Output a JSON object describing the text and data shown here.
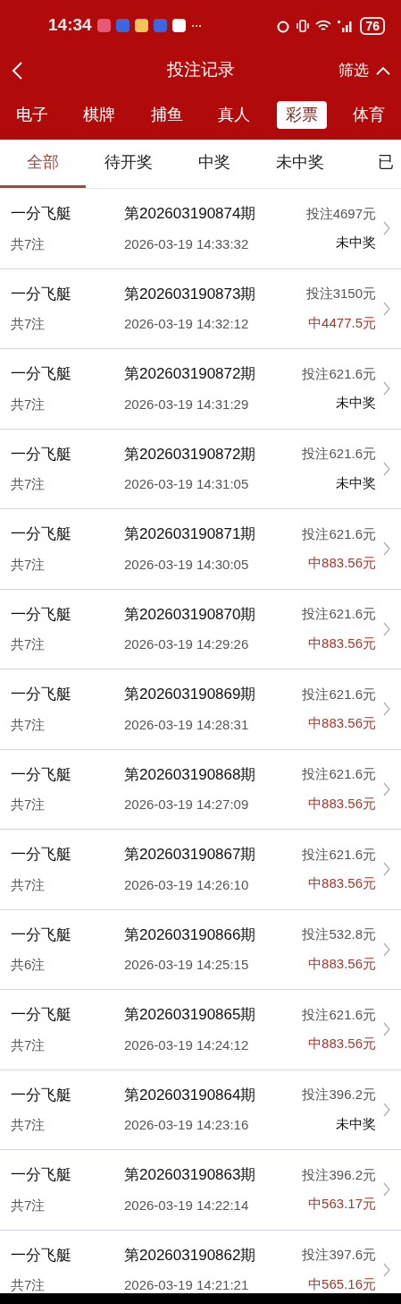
{
  "status_bar": {
    "time": "14:34",
    "battery": "76"
  },
  "header": {
    "title": "投注记录",
    "filter": "筛选"
  },
  "categories": [
    {
      "label": "电子",
      "selected": false
    },
    {
      "label": "棋牌",
      "selected": false
    },
    {
      "label": "捕鱼",
      "selected": false
    },
    {
      "label": "真人",
      "selected": false
    },
    {
      "label": "彩票",
      "selected": true
    },
    {
      "label": "体育",
      "selected": false
    }
  ],
  "tabs": [
    {
      "label": "全部",
      "selected": true
    },
    {
      "label": "待开奖",
      "selected": false
    },
    {
      "label": "中奖",
      "selected": false
    },
    {
      "label": "未中奖",
      "selected": false
    },
    {
      "label": "已",
      "selected": false
    }
  ],
  "records": [
    {
      "game": "一分飞艇",
      "count": "共7注",
      "issue": "第202603190874期",
      "time": "2026-03-19 14:33:32",
      "stake": "投注4697元",
      "result": "未中奖",
      "won": false
    },
    {
      "game": "一分飞艇",
      "count": "共7注",
      "issue": "第202603190873期",
      "time": "2026-03-19 14:32:12",
      "stake": "投注3150元",
      "result": "中4477.5元",
      "won": true
    },
    {
      "game": "一分飞艇",
      "count": "共7注",
      "issue": "第202603190872期",
      "time": "2026-03-19 14:31:29",
      "stake": "投注621.6元",
      "result": "未中奖",
      "won": false
    },
    {
      "game": "一分飞艇",
      "count": "共7注",
      "issue": "第202603190872期",
      "time": "2026-03-19 14:31:05",
      "stake": "投注621.6元",
      "result": "未中奖",
      "won": false
    },
    {
      "game": "一分飞艇",
      "count": "共7注",
      "issue": "第202603190871期",
      "time": "2026-03-19 14:30:05",
      "stake": "投注621.6元",
      "result": "中883.56元",
      "won": true
    },
    {
      "game": "一分飞艇",
      "count": "共7注",
      "issue": "第202603190870期",
      "time": "2026-03-19 14:29:26",
      "stake": "投注621.6元",
      "result": "中883.56元",
      "won": true
    },
    {
      "game": "一分飞艇",
      "count": "共7注",
      "issue": "第202603190869期",
      "time": "2026-03-19 14:28:31",
      "stake": "投注621.6元",
      "result": "中883.56元",
      "won": true
    },
    {
      "game": "一分飞艇",
      "count": "共7注",
      "issue": "第202603190868期",
      "time": "2026-03-19 14:27:09",
      "stake": "投注621.6元",
      "result": "中883.56元",
      "won": true
    },
    {
      "game": "一分飞艇",
      "count": "共7注",
      "issue": "第202603190867期",
      "time": "2026-03-19 14:26:10",
      "stake": "投注621.6元",
      "result": "中883.56元",
      "won": true
    },
    {
      "game": "一分飞艇",
      "count": "共6注",
      "issue": "第202603190866期",
      "time": "2026-03-19 14:25:15",
      "stake": "投注532.8元",
      "result": "中883.56元",
      "won": true
    },
    {
      "game": "一分飞艇",
      "count": "共7注",
      "issue": "第202603190865期",
      "time": "2026-03-19 14:24:12",
      "stake": "投注621.6元",
      "result": "中883.56元",
      "won": true
    },
    {
      "game": "一分飞艇",
      "count": "共7注",
      "issue": "第202603190864期",
      "time": "2026-03-19 14:23:16",
      "stake": "投注396.2元",
      "result": "未中奖",
      "won": false
    },
    {
      "game": "一分飞艇",
      "count": "共7注",
      "issue": "第202603190863期",
      "time": "2026-03-19 14:22:14",
      "stake": "投注396.2元",
      "result": "中563.17元",
      "won": true
    },
    {
      "game": "一分飞艇",
      "count": "共7注",
      "issue": "第202603190862期",
      "time": "2026-03-19 14:21:21",
      "stake": "投注397.6元",
      "result": "中565.16元",
      "won": true
    }
  ]
}
